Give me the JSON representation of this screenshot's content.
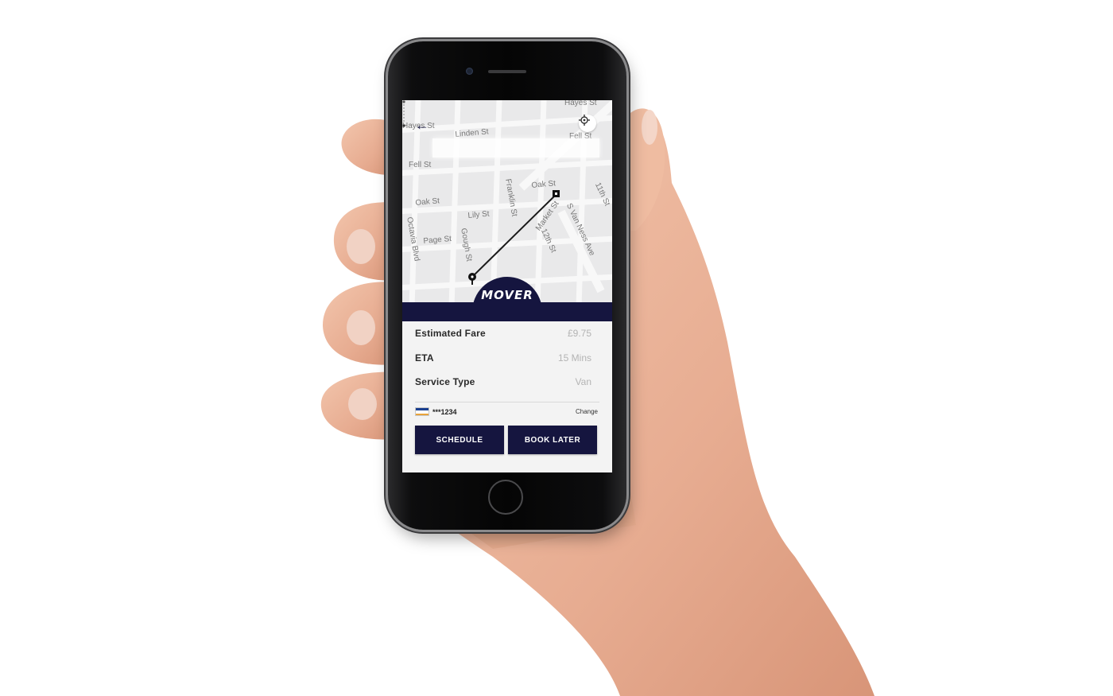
{
  "map": {
    "street_labels": [
      "Hayes St",
      "Hayes St",
      "Linden St",
      "Fell St",
      "Fell St",
      "Oak St",
      "Oak St",
      "Lily St",
      "Franklin St",
      "11th St",
      "Octavia Blvd",
      "Page St",
      "Gough St",
      "Market St",
      "12th St",
      "S Van Ness Ave"
    ]
  },
  "brand": {
    "logo_text": "MOVER",
    "color": "#15153f"
  },
  "details": {
    "rows": [
      {
        "label": "Estimated Fare",
        "value": "£9.75"
      },
      {
        "label": "ETA",
        "value": "15 Mins"
      },
      {
        "label": "Service Type",
        "value": "Van"
      }
    ],
    "card": {
      "brand": "VISA",
      "number": "***1234",
      "change_label": "Change"
    }
  },
  "actions": {
    "schedule_label": "SCHEDULE",
    "book_later_label": "BOOK LATER"
  },
  "icons": {
    "back": "back-arrow-icon",
    "locate": "crosshair-icon",
    "card": "visa-card-icon"
  }
}
